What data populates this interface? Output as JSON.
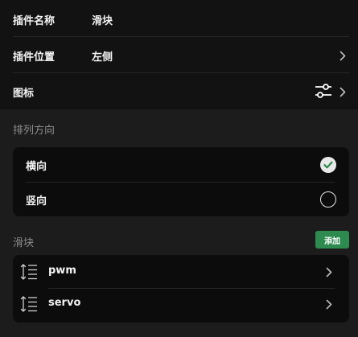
{
  "settings": {
    "plugin_name_label": "插件名称",
    "plugin_name_value": "滑块",
    "plugin_position_label": "插件位置",
    "plugin_position_value": "左侧",
    "icon_label": "图标"
  },
  "orientation": {
    "title": "排列方向",
    "options": [
      {
        "label": "横向",
        "selected": true
      },
      {
        "label": "竖向",
        "selected": false
      }
    ]
  },
  "sliders": {
    "title": "滑块",
    "add_label": "添加",
    "items": [
      {
        "name": "pwm"
      },
      {
        "name": "servo"
      }
    ]
  },
  "colors": {
    "accent": "#2e8b4f",
    "background": "#1c1c1c"
  }
}
